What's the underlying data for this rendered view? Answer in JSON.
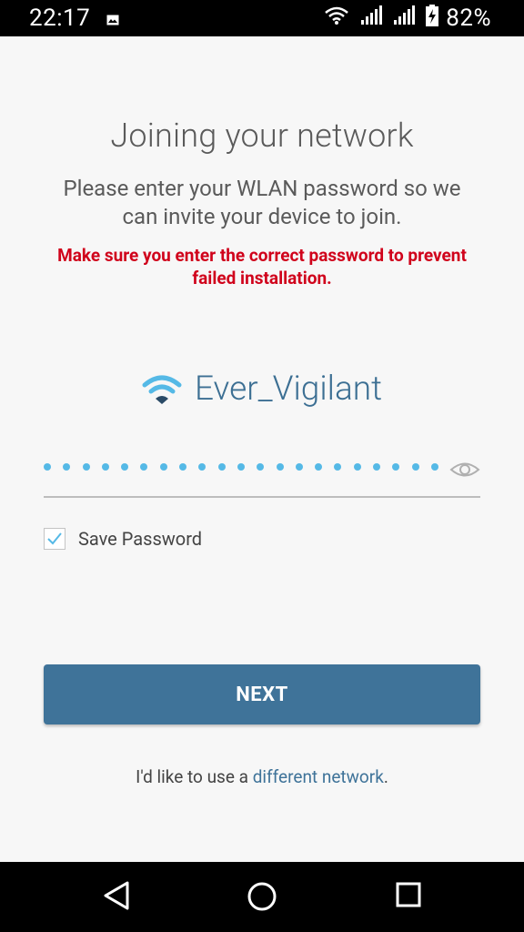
{
  "status_bar": {
    "time": "22:17",
    "battery": "82%",
    "icons": [
      "image-icon",
      "wifi-icon",
      "signal-icon",
      "signal-icon",
      "battery-charging-icon"
    ]
  },
  "page": {
    "title": "Joining your network",
    "subtitle": "Please enter your WLAN password so we can invite your device to join.",
    "warning": "Make sure you enter the correct password to prevent failed installation.",
    "network_name": "Ever_Vigilant",
    "password_dot_count": 21,
    "save_password_label": "Save Password",
    "save_password_checked": true,
    "next_label": "NEXT",
    "footer_prefix": "I'd like to use a ",
    "footer_link": "different network",
    "footer_suffix": "."
  },
  "nav_bar": {
    "icons": [
      "back-icon",
      "home-icon",
      "recents-icon"
    ]
  },
  "colors": {
    "accent": "#3f7399",
    "network_name": "#3c6f93",
    "warning": "#d0021b",
    "password_dot": "#55b9e6"
  }
}
